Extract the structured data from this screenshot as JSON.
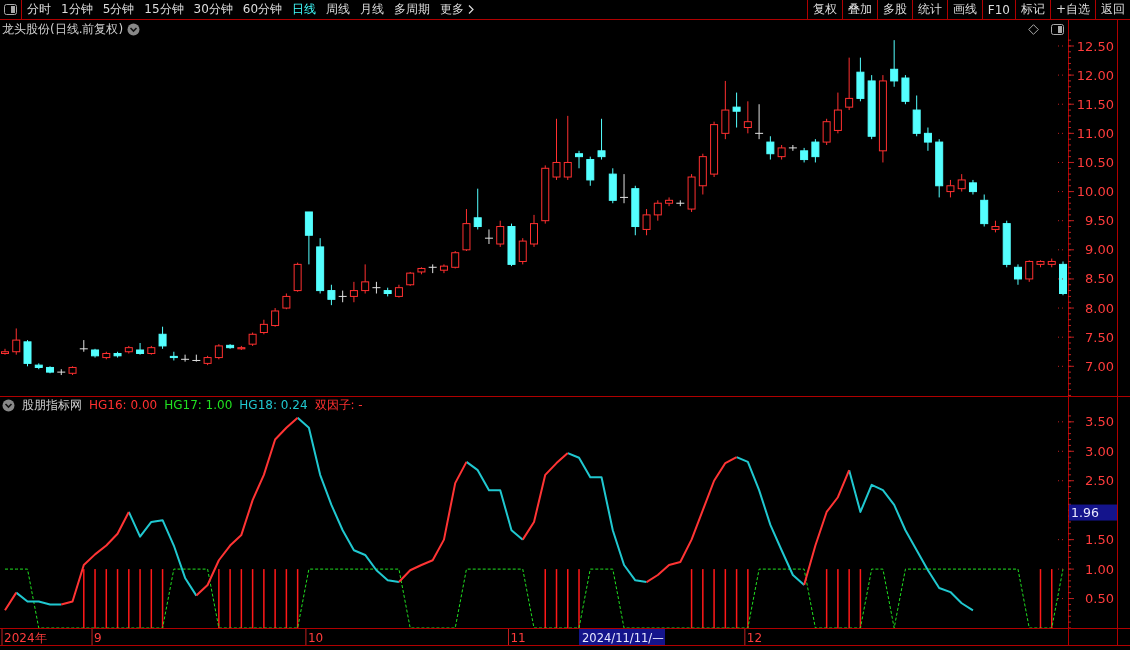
{
  "toolbar": {
    "periods": [
      {
        "label": "分时",
        "selected": false
      },
      {
        "label": "1分钟",
        "selected": false
      },
      {
        "label": "5分钟",
        "selected": false
      },
      {
        "label": "15分钟",
        "selected": false
      },
      {
        "label": "30分钟",
        "selected": false
      },
      {
        "label": "60分钟",
        "selected": false
      },
      {
        "label": "日线",
        "selected": true
      },
      {
        "label": "周线",
        "selected": false
      },
      {
        "label": "月线",
        "selected": false
      },
      {
        "label": "多周期",
        "selected": false
      }
    ],
    "more": "更多",
    "tools": [
      "复权",
      "叠加",
      "多股",
      "统计",
      "画线",
      "F10",
      "标记",
      "+自选",
      "返回"
    ]
  },
  "price_panel": {
    "title": "龙头股份(日线.前复权)",
    "chart_data": {
      "type": "candlestick",
      "ylim": [
        6.49,
        12.62
      ],
      "yticks": [
        {
          "value": 12.5,
          "label": "12.50"
        },
        {
          "value": 12,
          "label": "12.00"
        },
        {
          "value": 11.5,
          "label": "11.50"
        },
        {
          "value": 11,
          "label": "11.00"
        },
        {
          "value": 10.5,
          "label": "10.50"
        },
        {
          "value": 10,
          "label": "10.00"
        },
        {
          "value": 9.5,
          "label": "9.50"
        },
        {
          "value": 9,
          "label": "9.00"
        },
        {
          "value": 8.5,
          "label": "8.50"
        },
        {
          "value": 8,
          "label": "8.00"
        },
        {
          "value": 7.5,
          "label": "7.50"
        },
        {
          "value": 7,
          "label": "7.00"
        }
      ],
      "categories": [
        null,
        null,
        null,
        null,
        null,
        null,
        null,
        null,
        null,
        null,
        null,
        null,
        null,
        null,
        null,
        null,
        null,
        null,
        null,
        null,
        null,
        null,
        null,
        null,
        null,
        null,
        null,
        null,
        null,
        null,
        null,
        null,
        null,
        null,
        null,
        null,
        null,
        null,
        null,
        null,
        null,
        null,
        null,
        null,
        null,
        null,
        null,
        null,
        null,
        null,
        null,
        null,
        null,
        null,
        null,
        null,
        null,
        null,
        null,
        null,
        null,
        null,
        null,
        null,
        null,
        null,
        null,
        null,
        null,
        null,
        null,
        null,
        null,
        null,
        null,
        null,
        null,
        null,
        null,
        null,
        null,
        null,
        null,
        null,
        null,
        null,
        null,
        null,
        null,
        null,
        null,
        null,
        null,
        null,
        null
      ],
      "ohlc": [
        [
          7.22,
          7.3,
          7.2,
          7.25
        ],
        [
          7.25,
          7.65,
          7.2,
          7.45
        ],
        [
          7.42,
          7.45,
          7.0,
          7.05
        ],
        [
          7.02,
          7.05,
          6.95,
          6.98
        ],
        [
          6.98,
          7.0,
          6.88,
          6.9
        ],
        [
          6.9,
          6.95,
          6.85,
          6.9
        ],
        [
          6.88,
          7.0,
          6.85,
          6.98
        ],
        [
          7.3,
          7.45,
          7.25,
          7.3
        ],
        [
          7.28,
          7.3,
          7.15,
          7.18
        ],
        [
          7.15,
          7.25,
          7.12,
          7.22
        ],
        [
          7.22,
          7.25,
          7.15,
          7.18
        ],
        [
          7.25,
          7.35,
          7.22,
          7.32
        ],
        [
          7.28,
          7.4,
          7.2,
          7.22
        ],
        [
          7.22,
          7.35,
          7.2,
          7.32
        ],
        [
          7.55,
          7.68,
          7.3,
          7.35
        ],
        [
          7.17,
          7.25,
          7.1,
          7.15
        ],
        [
          7.12,
          7.2,
          7.08,
          7.12
        ],
        [
          7.1,
          7.2,
          7.08,
          7.1
        ],
        [
          7.05,
          7.18,
          7.02,
          7.15
        ],
        [
          7.15,
          7.38,
          7.12,
          7.35
        ],
        [
          7.36,
          7.38,
          7.3,
          7.32
        ],
        [
          7.3,
          7.35,
          7.28,
          7.32
        ],
        [
          7.38,
          7.58,
          7.35,
          7.55
        ],
        [
          7.58,
          7.8,
          7.55,
          7.72
        ],
        [
          7.7,
          8.0,
          7.68,
          7.95
        ],
        [
          8.0,
          8.25,
          7.98,
          8.2
        ],
        [
          8.3,
          8.78,
          8.28,
          8.75
        ],
        [
          9.65,
          9.65,
          8.75,
          9.25
        ],
        [
          9.05,
          9.2,
          8.25,
          8.3
        ],
        [
          8.3,
          8.4,
          8.05,
          8.15
        ],
        [
          8.2,
          8.3,
          8.1,
          8.2
        ],
        [
          8.2,
          8.45,
          8.1,
          8.3
        ],
        [
          8.3,
          8.75,
          8.25,
          8.45
        ],
        [
          8.35,
          8.45,
          8.25,
          8.35
        ],
        [
          8.3,
          8.35,
          8.2,
          8.25
        ],
        [
          8.2,
          8.4,
          8.18,
          8.35
        ],
        [
          8.4,
          8.62,
          8.38,
          8.6
        ],
        [
          8.62,
          8.7,
          8.58,
          8.68
        ],
        [
          8.7,
          8.75,
          8.6,
          8.7
        ],
        [
          8.65,
          8.75,
          8.6,
          8.72
        ],
        [
          8.7,
          8.98,
          8.68,
          8.95
        ],
        [
          9.0,
          9.7,
          8.98,
          9.45
        ],
        [
          9.55,
          10.05,
          9.35,
          9.4
        ],
        [
          9.2,
          9.35,
          9.1,
          9.2
        ],
        [
          9.1,
          9.5,
          9.05,
          9.4
        ],
        [
          9.4,
          9.45,
          8.72,
          8.75
        ],
        [
          8.8,
          9.2,
          8.75,
          9.15
        ],
        [
          9.1,
          9.6,
          9.05,
          9.45
        ],
        [
          9.5,
          10.45,
          9.45,
          10.4
        ],
        [
          10.25,
          11.25,
          10.2,
          10.5
        ],
        [
          10.25,
          11.3,
          10.2,
          10.5
        ],
        [
          10.65,
          10.7,
          10.4,
          10.6
        ],
        [
          10.55,
          10.6,
          10.1,
          10.2
        ],
        [
          10.7,
          11.25,
          10.55,
          10.6
        ],
        [
          10.3,
          10.4,
          9.8,
          9.85
        ],
        [
          9.9,
          10.3,
          9.8,
          9.9
        ],
        [
          10.05,
          10.1,
          9.25,
          9.4
        ],
        [
          9.35,
          9.7,
          9.25,
          9.6
        ],
        [
          9.6,
          9.85,
          9.5,
          9.8
        ],
        [
          9.8,
          9.9,
          9.75,
          9.85
        ],
        [
          9.8,
          9.85,
          9.75,
          9.8
        ],
        [
          9.7,
          10.3,
          9.65,
          10.25
        ],
        [
          10.1,
          10.65,
          9.95,
          10.6
        ],
        [
          10.3,
          11.2,
          10.25,
          11.15
        ],
        [
          11.0,
          11.9,
          10.9,
          11.4
        ],
        [
          11.45,
          11.7,
          11.1,
          11.38
        ],
        [
          11.1,
          11.55,
          11.0,
          11.2
        ],
        [
          11.0,
          11.5,
          10.9,
          11.0
        ],
        [
          10.85,
          10.95,
          10.55,
          10.65
        ],
        [
          10.6,
          10.8,
          10.55,
          10.75
        ],
        [
          10.75,
          10.8,
          10.7,
          10.75
        ],
        [
          10.7,
          10.75,
          10.5,
          10.55
        ],
        [
          10.85,
          10.9,
          10.5,
          10.6
        ],
        [
          10.85,
          11.25,
          10.8,
          11.2
        ],
        [
          11.05,
          11.7,
          11.0,
          11.4
        ],
        [
          11.45,
          12.3,
          11.4,
          11.6
        ],
        [
          12.05,
          12.3,
          11.55,
          11.6
        ],
        [
          11.9,
          12.0,
          10.9,
          10.95
        ],
        [
          10.7,
          12.0,
          10.5,
          11.9
        ],
        [
          12.1,
          12.6,
          11.8,
          11.9
        ],
        [
          11.95,
          12.0,
          11.5,
          11.55
        ],
        [
          11.4,
          11.65,
          10.95,
          11.0
        ],
        [
          11.0,
          11.1,
          10.7,
          10.85
        ],
        [
          10.85,
          10.9,
          9.9,
          10.1
        ],
        [
          10.0,
          10.2,
          9.9,
          10.1
        ],
        [
          10.05,
          10.3,
          10.0,
          10.2
        ],
        [
          10.15,
          10.2,
          9.95,
          10.0
        ],
        [
          9.85,
          9.95,
          9.4,
          9.45
        ],
        [
          9.35,
          9.5,
          9.3,
          9.4
        ],
        [
          9.45,
          9.5,
          8.7,
          8.75
        ],
        [
          8.7,
          8.75,
          8.4,
          8.5
        ],
        [
          8.5,
          8.82,
          8.45,
          8.8
        ],
        [
          8.75,
          8.82,
          8.7,
          8.8
        ],
        [
          8.75,
          8.85,
          8.7,
          8.8
        ],
        [
          8.75,
          8.8,
          8.22,
          8.25
        ]
      ]
    }
  },
  "indicator_panel": {
    "title": "股朋指标网",
    "legend": [
      {
        "label": "HG16: 0.00",
        "color": "#ff3030"
      },
      {
        "label": "HG17: 1.00",
        "color": "#20e020"
      },
      {
        "label": "HG18: 0.24",
        "color": "#20c8d0"
      },
      {
        "label": "双因子: -",
        "color": "#ff3030"
      }
    ],
    "current_value": "1.96",
    "chart_data": {
      "type": "line",
      "ylim": [
        0,
        3.65
      ],
      "categories": [
        null,
        null,
        null,
        null,
        null,
        null,
        null,
        null,
        null,
        null,
        null,
        null,
        null,
        null,
        null,
        null,
        null,
        null,
        null,
        null,
        null,
        null,
        null,
        null,
        null,
        null,
        null,
        null,
        null,
        null,
        null,
        null,
        null,
        null,
        null,
        null,
        null,
        null,
        null,
        null,
        null,
        null,
        null,
        null,
        null,
        null,
        null,
        null,
        null,
        null,
        null,
        null,
        null,
        null,
        null,
        null,
        null,
        null,
        null,
        null,
        null,
        null,
        null,
        null,
        null,
        null,
        null,
        null,
        null,
        null,
        null,
        null,
        null,
        null,
        null,
        null,
        null,
        null,
        null,
        null,
        null,
        null,
        null,
        null,
        null,
        null,
        null,
        null,
        null,
        null,
        null,
        null,
        null,
        null,
        null
      ],
      "yticks": [
        {
          "value": 3.5,
          "label": "3.50"
        },
        {
          "value": 3,
          "label": "3.00"
        },
        {
          "value": 2.5,
          "label": "2.50"
        },
        {
          "value": 1.5,
          "label": "1.50"
        },
        {
          "value": 1,
          "label": "1.00"
        },
        {
          "value": 0.5,
          "label": "0.50"
        }
      ],
      "series": [
        {
          "type": "bar",
          "color": "#ff1818",
          "values": [
            0,
            0,
            0,
            0,
            0,
            0,
            0,
            1,
            1,
            1,
            1,
            1,
            1,
            1,
            1,
            0,
            0,
            0,
            0,
            1,
            1,
            1,
            1,
            1,
            1,
            1,
            1,
            0,
            0,
            0,
            0,
            0,
            0,
            0,
            0,
            0,
            0,
            0,
            0,
            0,
            0,
            0,
            0,
            0,
            0,
            0,
            0,
            0,
            1,
            1,
            1,
            1,
            0,
            0,
            0,
            0,
            0,
            0,
            0,
            0,
            0,
            1,
            1,
            1,
            1,
            1,
            1,
            0,
            0,
            0,
            0,
            0,
            0,
            1,
            1,
            1,
            1,
            0,
            0,
            0,
            0,
            0,
            0,
            0,
            0,
            0,
            0,
            0,
            0,
            0,
            0,
            0,
            1,
            1,
            0
          ]
        },
        {
          "color": "#20e020",
          "line_style": "dashed",
          "values": [
            1,
            1,
            1,
            0,
            0,
            0,
            0,
            0,
            0,
            0,
            0,
            0,
            0,
            0,
            0,
            1,
            1,
            1,
            1,
            0,
            0,
            0,
            0,
            0,
            0,
            0,
            0,
            1,
            1,
            1,
            1,
            1,
            1,
            1,
            1,
            1,
            0,
            0,
            0,
            0,
            0,
            1,
            1,
            1,
            1,
            1,
            1,
            0,
            0,
            0,
            0,
            0,
            1,
            1,
            1,
            0,
            0,
            0,
            0,
            0,
            0,
            0,
            0,
            0,
            0,
            0,
            0,
            1,
            1,
            1,
            1,
            1,
            0,
            0,
            0,
            0,
            0,
            1,
            1,
            0,
            1,
            1,
            1,
            1,
            1,
            1,
            1,
            1,
            1,
            1,
            1,
            0,
            0,
            0,
            1
          ]
        },
        {
          "color": "#20c8d0",
          "values": [
            null,
            0.6,
            0.45,
            0.45,
            0.4,
            0.4,
            null,
            null,
            null,
            null,
            null,
            1.97,
            1.55,
            1.8,
            1.83,
            1.4,
            0.85,
            0.55,
            null,
            null,
            null,
            null,
            null,
            null,
            null,
            null,
            3.57,
            3.4,
            2.6,
            2.09,
            1.66,
            1.32,
            1.24,
            0.98,
            0.81,
            0.78,
            null,
            null,
            null,
            null,
            null,
            2.82,
            2.68,
            2.34,
            2.34,
            1.66,
            1.5,
            null,
            null,
            null,
            2.97,
            2.89,
            2.56,
            2.56,
            1.66,
            1.07,
            0.81,
            0.78,
            null,
            null,
            null,
            null,
            null,
            null,
            null,
            2.9,
            2.82,
            2.34,
            1.75,
            1.32,
            0.9,
            0.73,
            null,
            null,
            null,
            2.68,
            1.97,
            2.43,
            2.34,
            2.09,
            1.66,
            1.32,
            0.98,
            0.68,
            0.61,
            0.42,
            0.3,
            null,
            null,
            null,
            null,
            null,
            null,
            null,
            null
          ]
        },
        {
          "color": "#ff3434",
          "values": [
            0.3,
            0.6,
            null,
            null,
            null,
            0.4,
            0.45,
            1.07,
            1.25,
            1.4,
            1.6,
            1.97,
            null,
            null,
            null,
            null,
            null,
            0.55,
            0.73,
            1.15,
            1.4,
            1.58,
            2.17,
            2.6,
            3.2,
            3.4,
            3.57,
            null,
            null,
            null,
            null,
            null,
            null,
            null,
            null,
            0.78,
            0.98,
            1.07,
            1.15,
            1.5,
            2.46,
            2.82,
            null,
            null,
            null,
            null,
            1.5,
            1.8,
            2.6,
            2.8,
            2.97,
            null,
            null,
            null,
            null,
            null,
            null,
            0.78,
            0.9,
            1.07,
            1.12,
            1.5,
            2.0,
            2.5,
            2.8,
            2.9,
            null,
            null,
            null,
            null,
            null,
            0.73,
            1.4,
            1.97,
            2.22,
            2.68,
            null,
            null,
            null,
            null,
            null,
            null,
            null,
            null,
            null,
            null,
            null,
            null,
            null,
            null,
            null,
            null,
            null,
            null,
            null
          ]
        }
      ]
    }
  },
  "date_axis": {
    "labels": [
      "2024年",
      "9",
      "10",
      "11",
      "12"
    ],
    "cursor_date": "2024/11/11/—"
  }
}
